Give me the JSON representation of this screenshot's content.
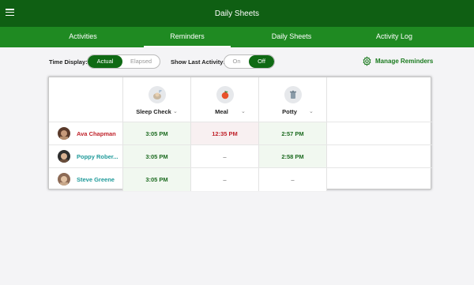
{
  "header": {
    "title": "Daily Sheets"
  },
  "tabs": [
    {
      "label": "Activities"
    },
    {
      "label": "Reminders"
    },
    {
      "label": "Daily Sheets"
    },
    {
      "label": "Activity Log"
    }
  ],
  "controls": {
    "time_display_label": "Time Display:",
    "time_display_options": [
      "Actual",
      "Elapsed"
    ],
    "time_display_selected": "Actual",
    "show_last_label": "Show Last Activity:",
    "show_last_options": [
      "On",
      "Off"
    ],
    "show_last_selected": "Off",
    "manage_reminders": "Manage Reminders"
  },
  "columns": [
    {
      "title": "Sleep Check",
      "icon": "sleep-icon"
    },
    {
      "title": "Meal",
      "icon": "apple-icon"
    },
    {
      "title": "Potty",
      "icon": "trash-can-icon"
    }
  ],
  "rows": [
    {
      "name": "Ava Chapman",
      "name_color": "#c0242c",
      "cells": [
        "3:05 PM",
        "12:35 PM",
        "2:57 PM"
      ]
    },
    {
      "name": "Poppy Rober...",
      "name_color": "#1f9a9a",
      "cells": [
        "3:05 PM",
        "–",
        "2:58 PM"
      ]
    },
    {
      "name": "Steve Greene",
      "name_color": "#1f9a9a",
      "cells": [
        "3:05 PM",
        "–",
        "–"
      ]
    }
  ],
  "colors": {
    "primary": "#0f5f13",
    "tabbar": "#1f8a22",
    "accent": "#1a7a1e",
    "alert": "#c0242c"
  }
}
